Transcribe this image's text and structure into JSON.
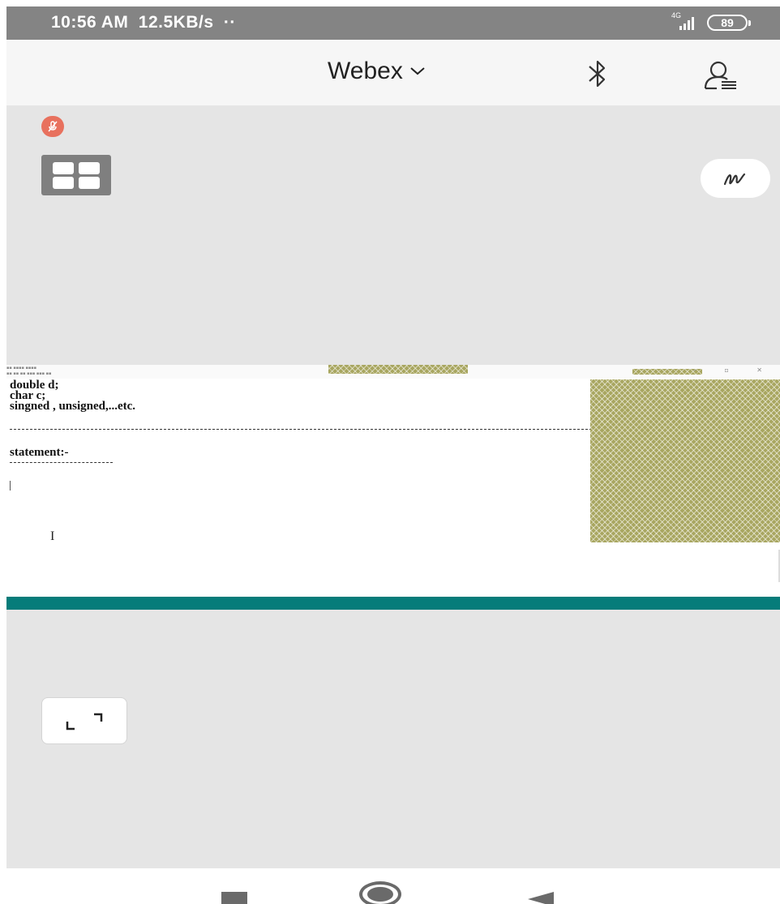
{
  "status_bar": {
    "time": "10:56 AM",
    "network_speed": "12.5KB/s",
    "notification_dots": "··",
    "network_type": "4G",
    "battery_level": "89",
    "icons": [
      "signal-icon",
      "battery-icon"
    ]
  },
  "header": {
    "title": "Webex",
    "title_icon": "chevron-down-icon",
    "bluetooth_icon": "bluetooth-icon",
    "participants_icon": "participants-icon"
  },
  "meeting": {
    "mute_icon": "muted-mic-icon",
    "layout_icon": "grid-layout-icon",
    "annotate_icon": "annotate-pen-icon",
    "fullscreen_icon": "expand-icon"
  },
  "shared_screen": {
    "code_lines": [
      "double d;",
      "char c;",
      "singned , unsigned,...etc."
    ],
    "statement_heading": "statement:-",
    "cursor_glyph": "I",
    "pattern_color": "#a8a660"
  },
  "colors": {
    "teal_bar": "#067c7a",
    "mute_badge": "#e8715e",
    "meeting_background": "#e5e5e5"
  },
  "nav_bar": {
    "icons": [
      "recents-icon",
      "home-icon",
      "back-icon"
    ]
  }
}
